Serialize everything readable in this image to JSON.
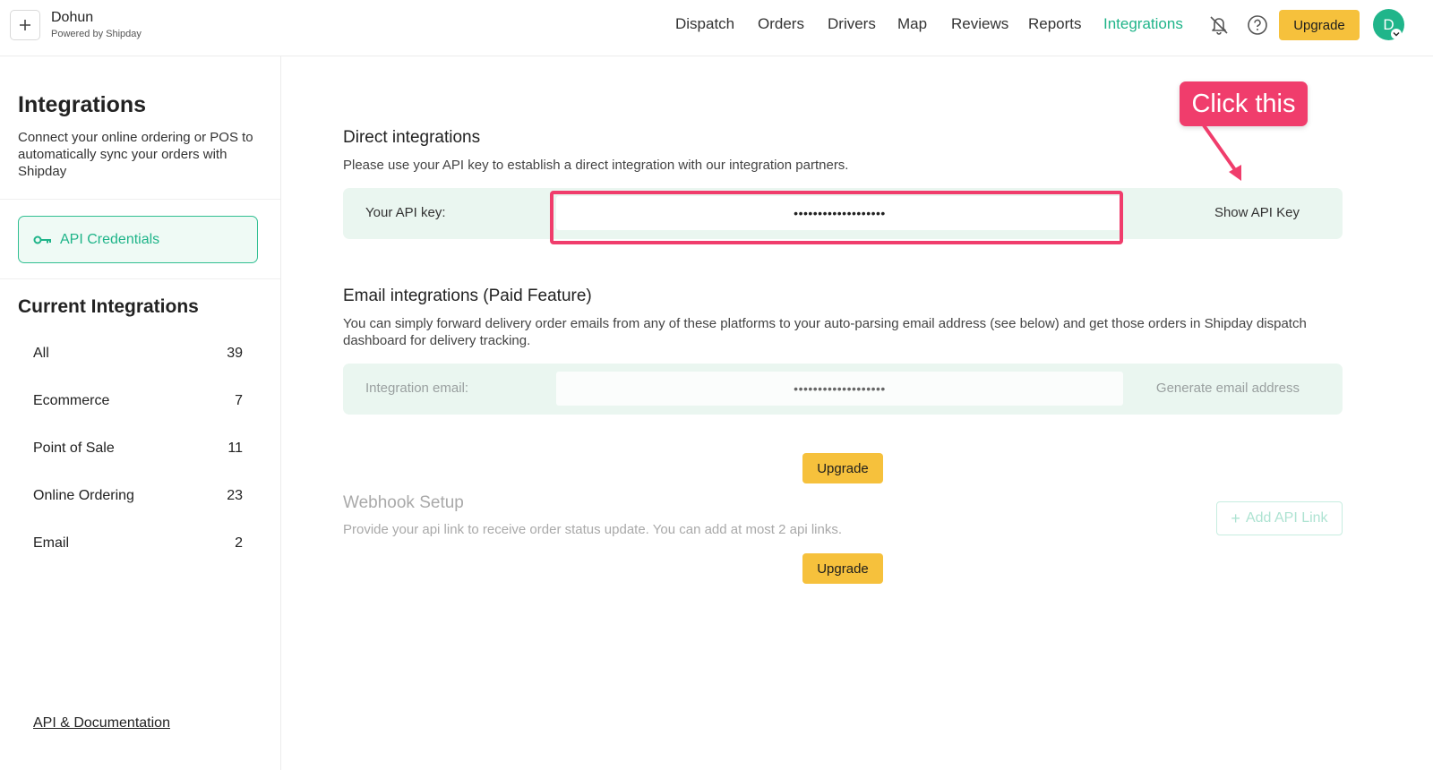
{
  "header": {
    "brand_name": "Dohun",
    "brand_sub": "Powered by Shipday",
    "nav": [
      "Dispatch",
      "Orders",
      "Drivers",
      "Map",
      "Reviews",
      "Reports",
      "Integrations"
    ],
    "active_nav": "Integrations",
    "upgrade_label": "Upgrade",
    "avatar_initial": "D",
    "icons": [
      "plus-icon",
      "bell-off-icon",
      "help-icon",
      "chevron-down-icon"
    ]
  },
  "sidebar": {
    "title": "Integrations",
    "description": "Connect your online ordering or POS to automatically sync your orders with Shipday",
    "api_credentials_label": "API Credentials",
    "current_title": "Current Integrations",
    "categories": [
      {
        "label": "All",
        "count": "39"
      },
      {
        "label": "Ecommerce",
        "count": "7"
      },
      {
        "label": "Point of Sale",
        "count": "11"
      },
      {
        "label": "Online Ordering",
        "count": "23"
      },
      {
        "label": "Email",
        "count": "2"
      }
    ],
    "api_doc_link": "API & Documentation"
  },
  "direct": {
    "title": "Direct integrations",
    "description": "Please use your API key to establish a direct integration with our integration partners.",
    "key_label": "Your API key:",
    "key_value": "•••••••••••••••••••",
    "show_label": "Show API Key"
  },
  "callout": {
    "text": "Click this"
  },
  "email": {
    "title": "Email integrations (Paid Feature)",
    "description": "You can simply forward delivery order emails from any of these platforms to your auto-parsing email address (see below) and get those orders in Shipday dispatch dashboard for delivery tracking.",
    "label": "Integration email:",
    "value": "•••••••••••••••••••",
    "action_label": "Generate email address",
    "upgrade_label": "Upgrade"
  },
  "webhook": {
    "title": "Webhook Setup",
    "description": "Provide your api link to receive order status update. You can add at most 2 api links.",
    "add_label": "Add API Link",
    "upgrade_label": "Upgrade"
  },
  "colors": {
    "accent": "#1fb489",
    "upgrade": "#f6c13c",
    "callout": "#f03d6c",
    "row_bg": "#eaf6f0"
  }
}
